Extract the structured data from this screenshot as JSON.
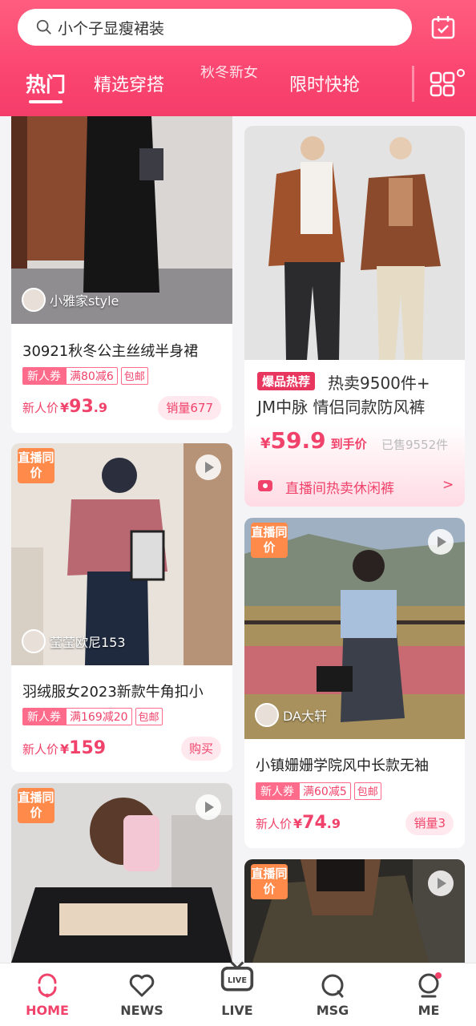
{
  "search": {
    "placeholder": "小个子显瘦裙装"
  },
  "tabs": [
    {
      "label": "热门",
      "active": true
    },
    {
      "label": "精选穿搭"
    },
    {
      "label": "秋冬新女装"
    },
    {
      "label": "限时快抢"
    }
  ],
  "cards": {
    "c1": {
      "author": "小雅家style",
      "title": "30921秋冬公主丝绒半身裙",
      "coupon_tag": "新人券",
      "coupon_rule": "满80减6",
      "shipping": "包邮",
      "price_label": "新人价",
      "currency": "¥",
      "price_int": "93",
      "price_dec": ".9",
      "sales": "销量677"
    },
    "c2": {
      "badge": "爆品热荐",
      "title_line1": "热卖9500件+",
      "title_line2": "JM中脉 情侣同款防风裤",
      "currency": "¥",
      "price": "59.9",
      "price_suffix": "到手价",
      "sold": "已售9552件",
      "live_banner": "直播间热卖休闲裤",
      "arrow": ">"
    },
    "c3": {
      "video_badge": "直播同价",
      "author": "莹莹欧尼153",
      "title": "羽绒服女2023新款牛角扣小",
      "coupon_tag": "新人券",
      "coupon_rule": "满169减20",
      "shipping": "包邮",
      "price_label": "新人价",
      "currency": "¥",
      "price_int": "159",
      "price_dec": "",
      "action": "购买"
    },
    "c4": {
      "video_badge": "直播同价",
      "author": "DA大轩",
      "title": "小镇姗姗学院风中长款无袖",
      "coupon_tag": "新人券",
      "coupon_rule": "满60减5",
      "shipping": "包邮",
      "price_label": "新人价",
      "currency": "¥",
      "price_int": "74",
      "price_dec": ".9",
      "sales": "销量3"
    },
    "c5": {
      "video_badge": "直播同价"
    },
    "c6": {
      "video_badge": "直播同价"
    }
  },
  "nav": [
    {
      "label": "HOME",
      "icon": "home-icon",
      "active": true
    },
    {
      "label": "NEWS",
      "icon": "heart-icon"
    },
    {
      "label": "LIVE",
      "icon": "live-tv-icon"
    },
    {
      "label": "MSG",
      "icon": "chat-bubble-icon"
    },
    {
      "label": "ME",
      "icon": "person-icon"
    }
  ],
  "colors": {
    "brand": "#f84a73",
    "price": "#f0426a",
    "badge_orange": "#ff8a4a"
  }
}
